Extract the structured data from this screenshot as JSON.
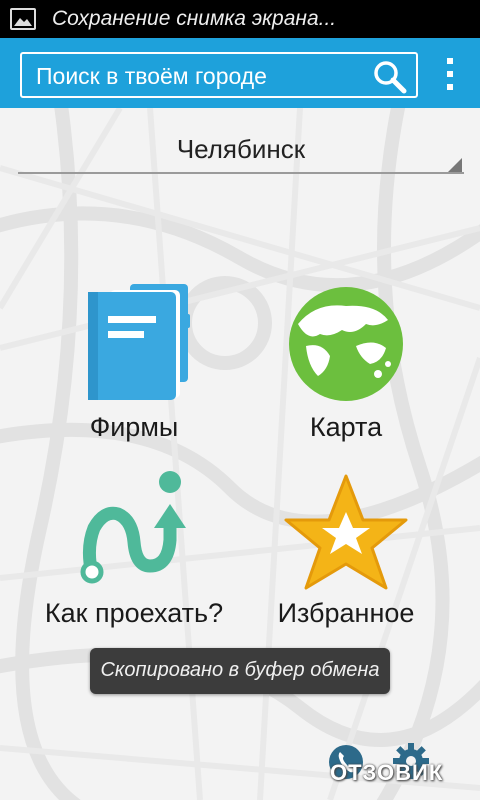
{
  "statusbar": {
    "notification_text": "Сохранение снимка экрана..."
  },
  "search": {
    "placeholder": "Поиск в твоём городе"
  },
  "city": {
    "name": "Челябинск"
  },
  "tiles": {
    "firms": {
      "label": "Фирмы",
      "icon": "directory-icon"
    },
    "map": {
      "label": "Карта",
      "icon": "globe-icon"
    },
    "route": {
      "label": "Как проехать?",
      "icon": "route-icon"
    },
    "favorites": {
      "label": "Избранное",
      "icon": "star-icon"
    }
  },
  "toast": {
    "text": "Скопировано в буфер обмена"
  },
  "bottom": {
    "call_icon": "phone-icon",
    "settings_icon": "gear-icon"
  },
  "watermark": {
    "text": "ОТЗОВИК"
  },
  "colors": {
    "actionbar": "#1ea1db",
    "directory": "#3aa8e0",
    "globe": "#6cbf3e",
    "route": "#4fb99a",
    "star": "#f4b417"
  }
}
